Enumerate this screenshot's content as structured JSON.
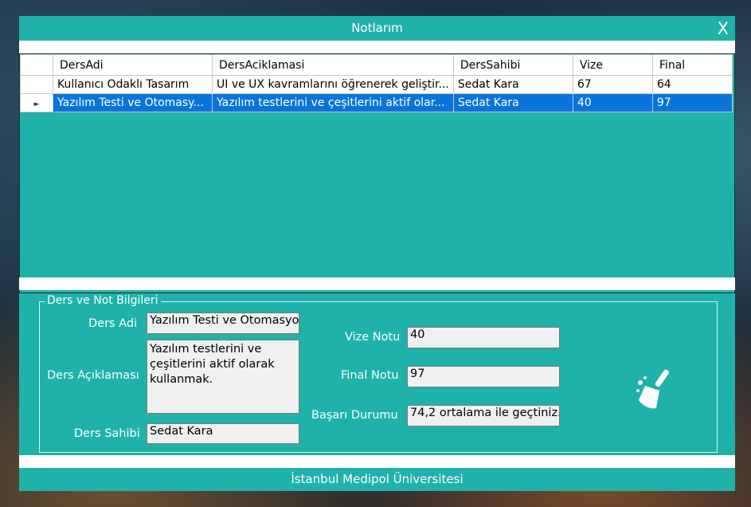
{
  "window": {
    "title": "Notlarım",
    "close_label": "X"
  },
  "grid": {
    "columns": [
      "DersAdi",
      "DersAciklamasi",
      "DersSahibi",
      "Vize",
      "Final"
    ],
    "rows": [
      {
        "values": [
          "Kullanıcı Odaklı Tasarım",
          "UI ve UX kavramlarını öğrenerek geliştir...",
          "Sedat Kara",
          "67",
          "64"
        ],
        "selected": false
      },
      {
        "values": [
          "Yazılım Testi ve Otomasy...",
          "Yazılım testlerini ve çeşitlerini aktif olar...",
          "Sedat Kara",
          "40",
          "97"
        ],
        "selected": true
      }
    ],
    "row_indicator": "►"
  },
  "details": {
    "title": "Ders ve Not Bilgileri",
    "ders_adi_label": "Ders Adi",
    "ders_adi_value": "Yazılım Testi ve Otomasyo",
    "ders_aciklamasi_label": "Ders Açıklaması",
    "ders_aciklamasi_value": "Yazılım testlerini ve çeşitlerini aktif olarak kullanmak.",
    "ders_sahibi_label": "Ders Sahibi",
    "ders_sahibi_value": "Sedat Kara",
    "vize_label": "Vize Notu",
    "vize_value": "40",
    "final_label": "Final Notu",
    "final_value": "97",
    "basari_label": "Başarı Durumu",
    "basari_value": "74,2 ortalama ile geçtiniz.",
    "clear_icon": "broom-icon"
  },
  "footer": {
    "text": "İstanbul Medipol Üniversitesi"
  },
  "colors": {
    "accent": "#20b2aa",
    "selection": "#0a74da"
  }
}
